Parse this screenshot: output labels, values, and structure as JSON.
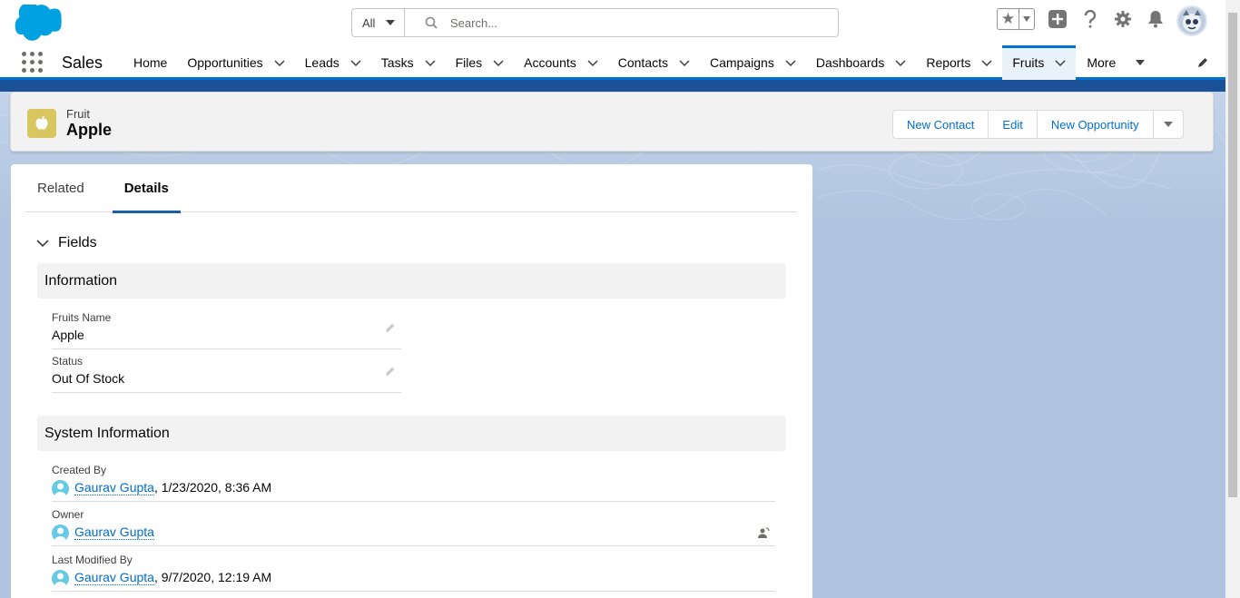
{
  "header": {
    "search": {
      "scope": "All",
      "placeholder": "Search..."
    }
  },
  "nav": {
    "app_name": "Sales",
    "items": [
      {
        "label": "Home",
        "dropdown": false,
        "active": false
      },
      {
        "label": "Opportunities",
        "dropdown": true,
        "active": false
      },
      {
        "label": "Leads",
        "dropdown": true,
        "active": false
      },
      {
        "label": "Tasks",
        "dropdown": true,
        "active": false
      },
      {
        "label": "Files",
        "dropdown": true,
        "active": false
      },
      {
        "label": "Accounts",
        "dropdown": true,
        "active": false
      },
      {
        "label": "Contacts",
        "dropdown": true,
        "active": false
      },
      {
        "label": "Campaigns",
        "dropdown": true,
        "active": false
      },
      {
        "label": "Dashboards",
        "dropdown": true,
        "active": false
      },
      {
        "label": "Reports",
        "dropdown": true,
        "active": false
      },
      {
        "label": "Fruits",
        "dropdown": true,
        "active": true
      }
    ],
    "more_label": "More"
  },
  "record": {
    "object_type": "Fruit",
    "name": "Apple",
    "icon_color": "#d8c760",
    "actions": [
      "New Contact",
      "Edit",
      "New Opportunity"
    ]
  },
  "tabs": {
    "related": "Related",
    "details": "Details"
  },
  "detail": {
    "fields_toggle": "Fields",
    "information": {
      "title": "Information",
      "fruits_name_label": "Fruits Name",
      "fruits_name_value": "Apple",
      "status_label": "Status",
      "status_value": "Out Of Stock"
    },
    "system": {
      "title": "System Information",
      "created_by_label": "Created By",
      "created_by_user": "Gaurav Gupta",
      "created_by_date": ", 1/23/2020, 8:36 AM",
      "owner_label": "Owner",
      "owner_user": "Gaurav Gupta",
      "modified_by_label": "Last Modified By",
      "modified_by_user": "Gaurav Gupta",
      "modified_by_date": ", 9/7/2020, 12:19 AM"
    }
  },
  "colors": {
    "brand_blue": "#0070d2",
    "link": "#006dcc",
    "background": "#b0c4df"
  }
}
